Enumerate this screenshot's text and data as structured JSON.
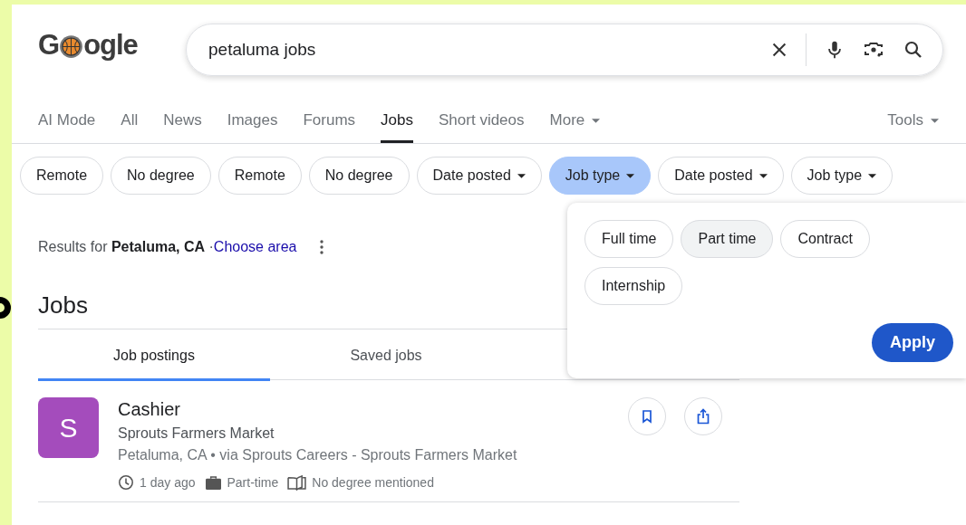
{
  "logo": {
    "first": "G",
    "rest": "ogle"
  },
  "search": {
    "value": "petaluma jobs"
  },
  "tabs": [
    {
      "label": "AI Mode",
      "selected": false,
      "dropdown": false
    },
    {
      "label": "All",
      "selected": false,
      "dropdown": false
    },
    {
      "label": "News",
      "selected": false,
      "dropdown": false
    },
    {
      "label": "Images",
      "selected": false,
      "dropdown": false
    },
    {
      "label": "Forums",
      "selected": false,
      "dropdown": false
    },
    {
      "label": "Jobs",
      "selected": true,
      "dropdown": false
    },
    {
      "label": "Short videos",
      "selected": false,
      "dropdown": false
    },
    {
      "label": "More",
      "selected": false,
      "dropdown": true
    }
  ],
  "tools": {
    "label": "Tools"
  },
  "filters": [
    {
      "label": "Remote",
      "dropdown": false,
      "selected": false
    },
    {
      "label": "No degree",
      "dropdown": false,
      "selected": false
    },
    {
      "label": "Remote",
      "dropdown": false,
      "selected": false
    },
    {
      "label": "No degree",
      "dropdown": false,
      "selected": false
    },
    {
      "label": "Date posted",
      "dropdown": true,
      "selected": false
    },
    {
      "label": "Job type",
      "dropdown": true,
      "selected": true
    },
    {
      "label": "Date posted",
      "dropdown": true,
      "selected": false
    },
    {
      "label": "Job type",
      "dropdown": true,
      "selected": false
    }
  ],
  "location": {
    "prefix": "Results for",
    "place": "Petaluma, CA",
    "separator": "·",
    "link": "Choose area"
  },
  "section_title": "Jobs",
  "job_tabs": [
    {
      "label": "Job postings",
      "selected": true
    },
    {
      "label": "Saved jobs",
      "selected": false
    }
  ],
  "jobs": [
    {
      "initial": "S",
      "color": "#a44cbc",
      "title": "Cashier",
      "company": "Sprouts Farmers Market",
      "location": "Petaluma, CA • via Sprouts Careers - Sprouts Farmers Market",
      "posted": "1 day ago",
      "type": "Part-time",
      "education": "No degree mentioned"
    }
  ],
  "job_type_menu": {
    "options": [
      {
        "label": "Full time",
        "selected": false
      },
      {
        "label": "Part time",
        "selected": true
      },
      {
        "label": "Contract",
        "selected": false
      },
      {
        "label": "Internship",
        "selected": false
      }
    ],
    "apply": "Apply"
  }
}
